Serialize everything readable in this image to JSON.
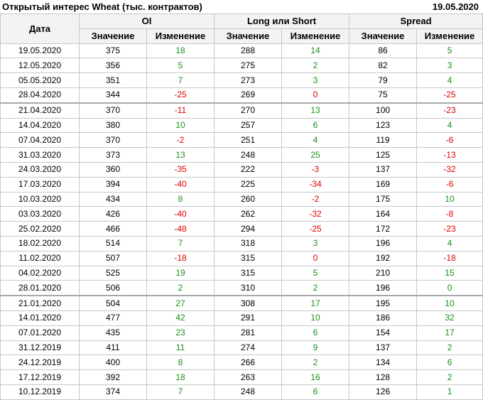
{
  "header": {
    "title": "Открытый интерес Wheat (тыс. контрактов)",
    "date": "19.05.2020"
  },
  "table": {
    "col_date": "Дата",
    "groups": [
      "OI",
      "Long или Short",
      "Spread"
    ],
    "sub_value": "Значение",
    "sub_change": "Изменение",
    "rows": [
      {
        "date": "19.05.2020",
        "oi": "375",
        "oi_ch": "18",
        "ls": "288",
        "ls_ch": "14",
        "sp": "86",
        "sp_ch": "5"
      },
      {
        "date": "12.05.2020",
        "oi": "356",
        "oi_ch": "5",
        "ls": "275",
        "ls_ch": "2",
        "sp": "82",
        "sp_ch": "3"
      },
      {
        "date": "05.05.2020",
        "oi": "351",
        "oi_ch": "7",
        "ls": "273",
        "ls_ch": "3",
        "sp": "79",
        "sp_ch": "4"
      },
      {
        "date": "28.04.2020",
        "oi": "344",
        "oi_ch": "-25",
        "ls": "269",
        "ls_ch": "0",
        "sp": "75",
        "sp_ch": "-25"
      },
      {
        "date": "21.04.2020",
        "oi": "370",
        "oi_ch": "-11",
        "ls": "270",
        "ls_ch": "13",
        "sp": "100",
        "sp_ch": "-23"
      },
      {
        "date": "14.04.2020",
        "oi": "380",
        "oi_ch": "10",
        "ls": "257",
        "ls_ch": "6",
        "sp": "123",
        "sp_ch": "4"
      },
      {
        "date": "07.04.2020",
        "oi": "370",
        "oi_ch": "-2",
        "ls": "251",
        "ls_ch": "4",
        "sp": "119",
        "sp_ch": "-6"
      },
      {
        "date": "31.03.2020",
        "oi": "373",
        "oi_ch": "13",
        "ls": "248",
        "ls_ch": "25",
        "sp": "125",
        "sp_ch": "-13"
      },
      {
        "date": "24.03.2020",
        "oi": "360",
        "oi_ch": "-35",
        "ls": "222",
        "ls_ch": "-3",
        "sp": "137",
        "sp_ch": "-32"
      },
      {
        "date": "17.03.2020",
        "oi": "394",
        "oi_ch": "-40",
        "ls": "225",
        "ls_ch": "-34",
        "sp": "169",
        "sp_ch": "-6"
      },
      {
        "date": "10.03.2020",
        "oi": "434",
        "oi_ch": "8",
        "ls": "260",
        "ls_ch": "-2",
        "sp": "175",
        "sp_ch": "10"
      },
      {
        "date": "03.03.2020",
        "oi": "426",
        "oi_ch": "-40",
        "ls": "262",
        "ls_ch": "-32",
        "sp": "164",
        "sp_ch": "-8"
      },
      {
        "date": "25.02.2020",
        "oi": "466",
        "oi_ch": "-48",
        "ls": "294",
        "ls_ch": "-25",
        "sp": "172",
        "sp_ch": "-23"
      },
      {
        "date": "18.02.2020",
        "oi": "514",
        "oi_ch": "7",
        "ls": "318",
        "ls_ch": "3",
        "sp": "196",
        "sp_ch": "4"
      },
      {
        "date": "11.02.2020",
        "oi": "507",
        "oi_ch": "-18",
        "ls": "315",
        "ls_ch": "0",
        "sp": "192",
        "sp_ch": "-18"
      },
      {
        "date": "04.02.2020",
        "oi": "525",
        "oi_ch": "19",
        "ls": "315",
        "ls_ch": "5",
        "sp": "210",
        "sp_ch": "15"
      },
      {
        "date": "28.01.2020",
        "oi": "506",
        "oi_ch": "2",
        "ls": "310",
        "ls_ch": "2",
        "sp": "196",
        "sp_ch": "0"
      },
      {
        "date": "21.01.2020",
        "oi": "504",
        "oi_ch": "27",
        "ls": "308",
        "ls_ch": "17",
        "sp": "195",
        "sp_ch": "10"
      },
      {
        "date": "14.01.2020",
        "oi": "477",
        "oi_ch": "42",
        "ls": "291",
        "ls_ch": "10",
        "sp": "186",
        "sp_ch": "32"
      },
      {
        "date": "07.01.2020",
        "oi": "435",
        "oi_ch": "23",
        "ls": "281",
        "ls_ch": "6",
        "sp": "154",
        "sp_ch": "17"
      },
      {
        "date": "31.12.2019",
        "oi": "411",
        "oi_ch": "11",
        "ls": "274",
        "ls_ch": "9",
        "sp": "137",
        "sp_ch": "2"
      },
      {
        "date": "24.12.2019",
        "oi": "400",
        "oi_ch": "8",
        "ls": "266",
        "ls_ch": "2",
        "sp": "134",
        "sp_ch": "6"
      },
      {
        "date": "17.12.2019",
        "oi": "392",
        "oi_ch": "18",
        "ls": "263",
        "ls_ch": "16",
        "sp": "128",
        "sp_ch": "2"
      },
      {
        "date": "10.12.2019",
        "oi": "374",
        "oi_ch": "7",
        "ls": "248",
        "ls_ch": "6",
        "sp": "126",
        "sp_ch": "1"
      }
    ]
  },
  "colors": {
    "positive": "#1a8f1a",
    "negative": "#e00000"
  }
}
